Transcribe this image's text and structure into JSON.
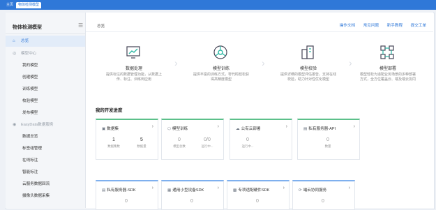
{
  "tabs": [
    "主页",
    "物体检测模型"
  ],
  "sidebar": {
    "title": "物体检测模型",
    "items": [
      {
        "label": "总览",
        "icon": "home-icon",
        "kind": "active"
      },
      {
        "label": "模型中心",
        "icon": "model-icon",
        "kind": "group"
      },
      {
        "label": "我的模型",
        "kind": "sub"
      },
      {
        "label": "创建模型",
        "kind": "sub"
      },
      {
        "label": "训练模型",
        "kind": "sub"
      },
      {
        "label": "校验模型",
        "kind": "sub"
      },
      {
        "label": "发布模型",
        "kind": "sub"
      },
      {
        "label": "EasyData数据服务",
        "icon": "data-icon",
        "kind": "group"
      },
      {
        "label": "数据总览",
        "kind": "sub"
      },
      {
        "label": "标签组管理",
        "kind": "sub"
      },
      {
        "label": "在线标注",
        "kind": "sub"
      },
      {
        "label": "智能标注",
        "kind": "sub"
      },
      {
        "label": "云服务数据回流",
        "kind": "sub"
      },
      {
        "label": "摄像头数据采集",
        "kind": "sub"
      }
    ]
  },
  "header": {
    "breadcrumb": "总览",
    "links": [
      "操作文档",
      "常见问题",
      "新手教程",
      "提交工单"
    ]
  },
  "flow": [
    {
      "title": "数据处理",
      "desc": "提供标注的数据管理功能，从数据上传、标注、训练到应用"
    },
    {
      "title": "模型训练",
      "desc": "提供丰富的训练方式，零代码轻松获得高精度模型"
    },
    {
      "title": "模型校验",
      "desc": "提供详细的模型评估报告，支持在线校验，助力针对性优化模型"
    },
    {
      "title": "模型部署",
      "desc": "模型轻松为适配业务场景的多种部署方式，全方位覆盖云、端及端云协同"
    }
  ],
  "progress": {
    "title": "我的开发进度",
    "cards": [
      {
        "title": "数据集",
        "icon": "database-icon",
        "stats": [
          {
            "value": "1",
            "label": "数据集数"
          },
          {
            "value": "5",
            "label": "数据量"
          }
        ]
      },
      {
        "title": "模型训练",
        "icon": "cube-icon",
        "stats": [
          {
            "value": "0",
            "label": "模型总数"
          },
          {
            "value": "0/0",
            "label": "运行中..."
          }
        ]
      },
      {
        "title": "公有云部署",
        "icon": "cloud-icon",
        "stats": [
          {
            "value": "0",
            "label": "运行中..."
          }
        ]
      },
      {
        "title": "私有服务器-API",
        "icon": "server-icon",
        "stats": [
          {
            "value": "0",
            "label": "数量"
          }
        ]
      },
      {
        "title": "私有服务器-SDK",
        "icon": "server-icon",
        "stats": [
          {
            "value": "0",
            "label": ""
          }
        ]
      },
      {
        "title": "通用小型设备SDK",
        "icon": "device-icon",
        "stats": [
          {
            "value": "0",
            "label": ""
          }
        ]
      },
      {
        "title": "专项适配硬件SDK",
        "icon": "chip-icon",
        "stats": [
          {
            "value": "0",
            "label": ""
          }
        ]
      },
      {
        "title": "端云协同服务",
        "icon": "sync-icon",
        "stats": [
          {
            "value": "0",
            "label": ""
          }
        ]
      }
    ]
  },
  "colors": {
    "accent": "#2f78d8",
    "card_top_green": "#5cc08a",
    "card_top_blue": "#7fb0ee"
  }
}
